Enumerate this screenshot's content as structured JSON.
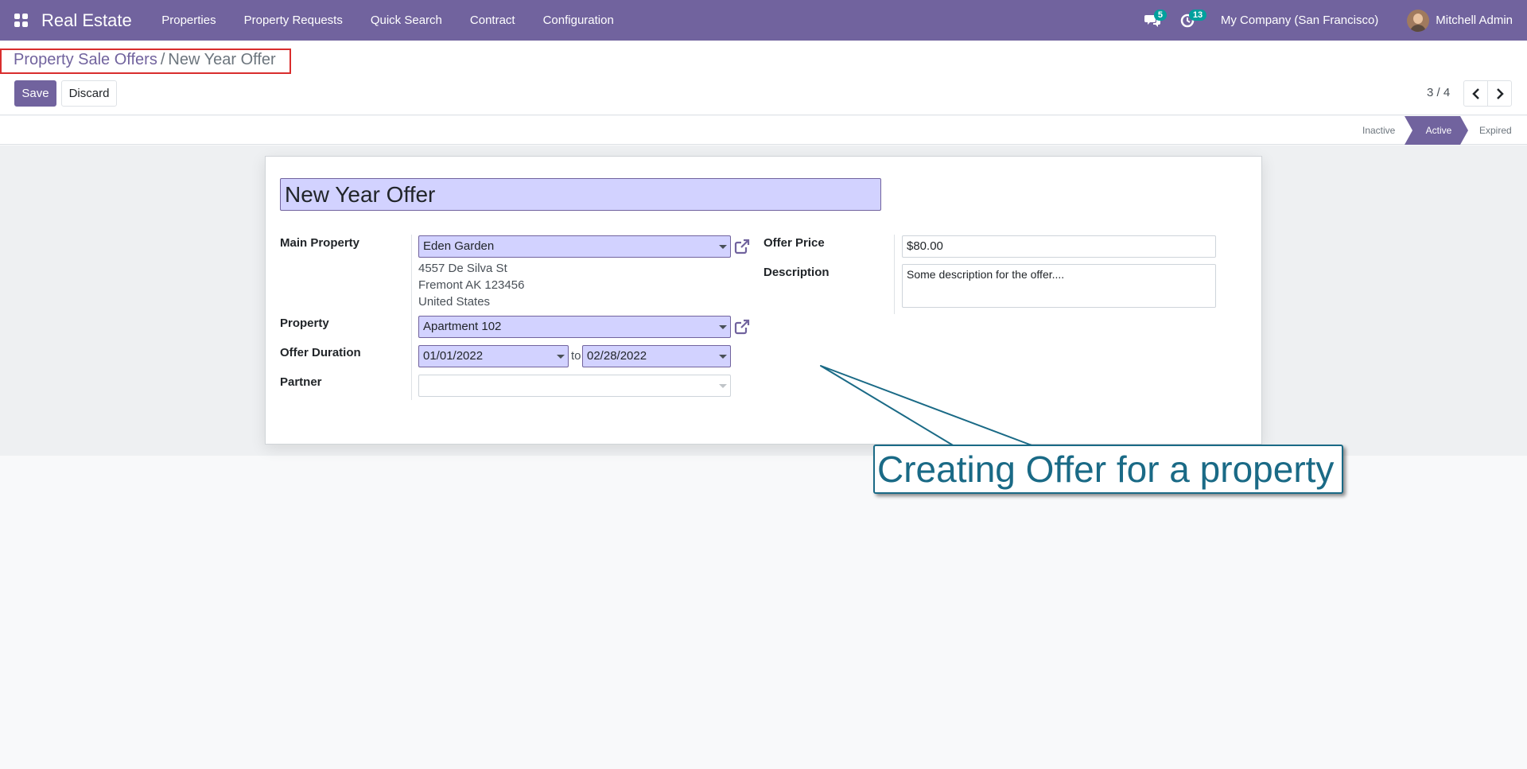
{
  "navbar": {
    "app_name": "Real Estate",
    "menu": [
      {
        "label": "Properties"
      },
      {
        "label": "Property Requests"
      },
      {
        "label": "Quick Search"
      },
      {
        "label": "Contract"
      },
      {
        "label": "Configuration"
      }
    ],
    "messages_count": "5",
    "activities_count": "13",
    "company": "My Company (San Francisco)",
    "user": "Mitchell Admin"
  },
  "breadcrumb": {
    "parent": "Property Sale Offers",
    "separator": "/",
    "current": "New Year Offer"
  },
  "actions": {
    "save_label": "Save",
    "discard_label": "Discard"
  },
  "pager": {
    "value": "3 / 4"
  },
  "statusbar": {
    "stages": [
      {
        "label": "Inactive"
      },
      {
        "label": "Active",
        "active": true
      },
      {
        "label": "Expired"
      }
    ]
  },
  "form": {
    "name": "New Year Offer",
    "main_property": {
      "label": "Main Property",
      "value": "Eden Garden",
      "address": [
        "4557 De Silva St",
        "Fremont AK 123456",
        "United States"
      ]
    },
    "property": {
      "label": "Property",
      "value": "Apartment 102"
    },
    "offer_duration": {
      "label": "Offer Duration",
      "from": "01/01/2022",
      "to_text": "to",
      "to": "02/28/2022"
    },
    "partner": {
      "label": "Partner",
      "value": ""
    },
    "offer_price": {
      "label": "Offer Price",
      "value": "$80.00"
    },
    "description": {
      "label": "Description",
      "value": "Some description for the offer...."
    }
  },
  "annotation": {
    "text": "Creating Offer for a property"
  },
  "colors": {
    "brand": "#71639e",
    "field_required_bg": "#d2d2ff",
    "badge": "#00a09d",
    "annotation": "#1a6a86",
    "highlight_border": "#d92d2d"
  }
}
